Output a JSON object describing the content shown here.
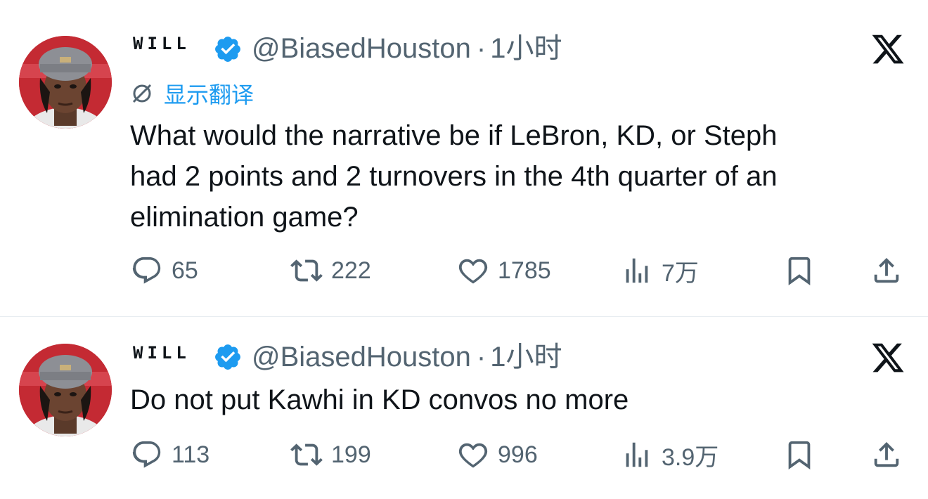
{
  "colors": {
    "accent": "#1d9bf0",
    "secondary_text": "#536471",
    "primary_text": "#0f1419"
  },
  "tweets": [
    {
      "name": "WILL",
      "handle": "@BiasedHouston",
      "separator": "·",
      "time": "1小时",
      "translate_label": "显示翻译",
      "text": "What would the narrative be if LeBron, KD, or Steph\nhad 2 points and 2 turnovers in the 4th quarter of an\nelimination game?",
      "replies": "65",
      "retweets": "222",
      "likes": "1785",
      "views": "7万"
    },
    {
      "name": "WILL",
      "handle": "@BiasedHouston",
      "separator": "·",
      "time": "1小时",
      "text": "Do not put Kawhi in KD convos no more",
      "replies": "113",
      "retweets": "199",
      "likes": "996",
      "views": "3.9万"
    }
  ],
  "icons": [
    "verified-badge-icon",
    "x-logo-icon",
    "translate-icon",
    "reply-icon",
    "retweet-icon",
    "like-icon",
    "views-icon",
    "bookmark-icon",
    "share-icon"
  ]
}
